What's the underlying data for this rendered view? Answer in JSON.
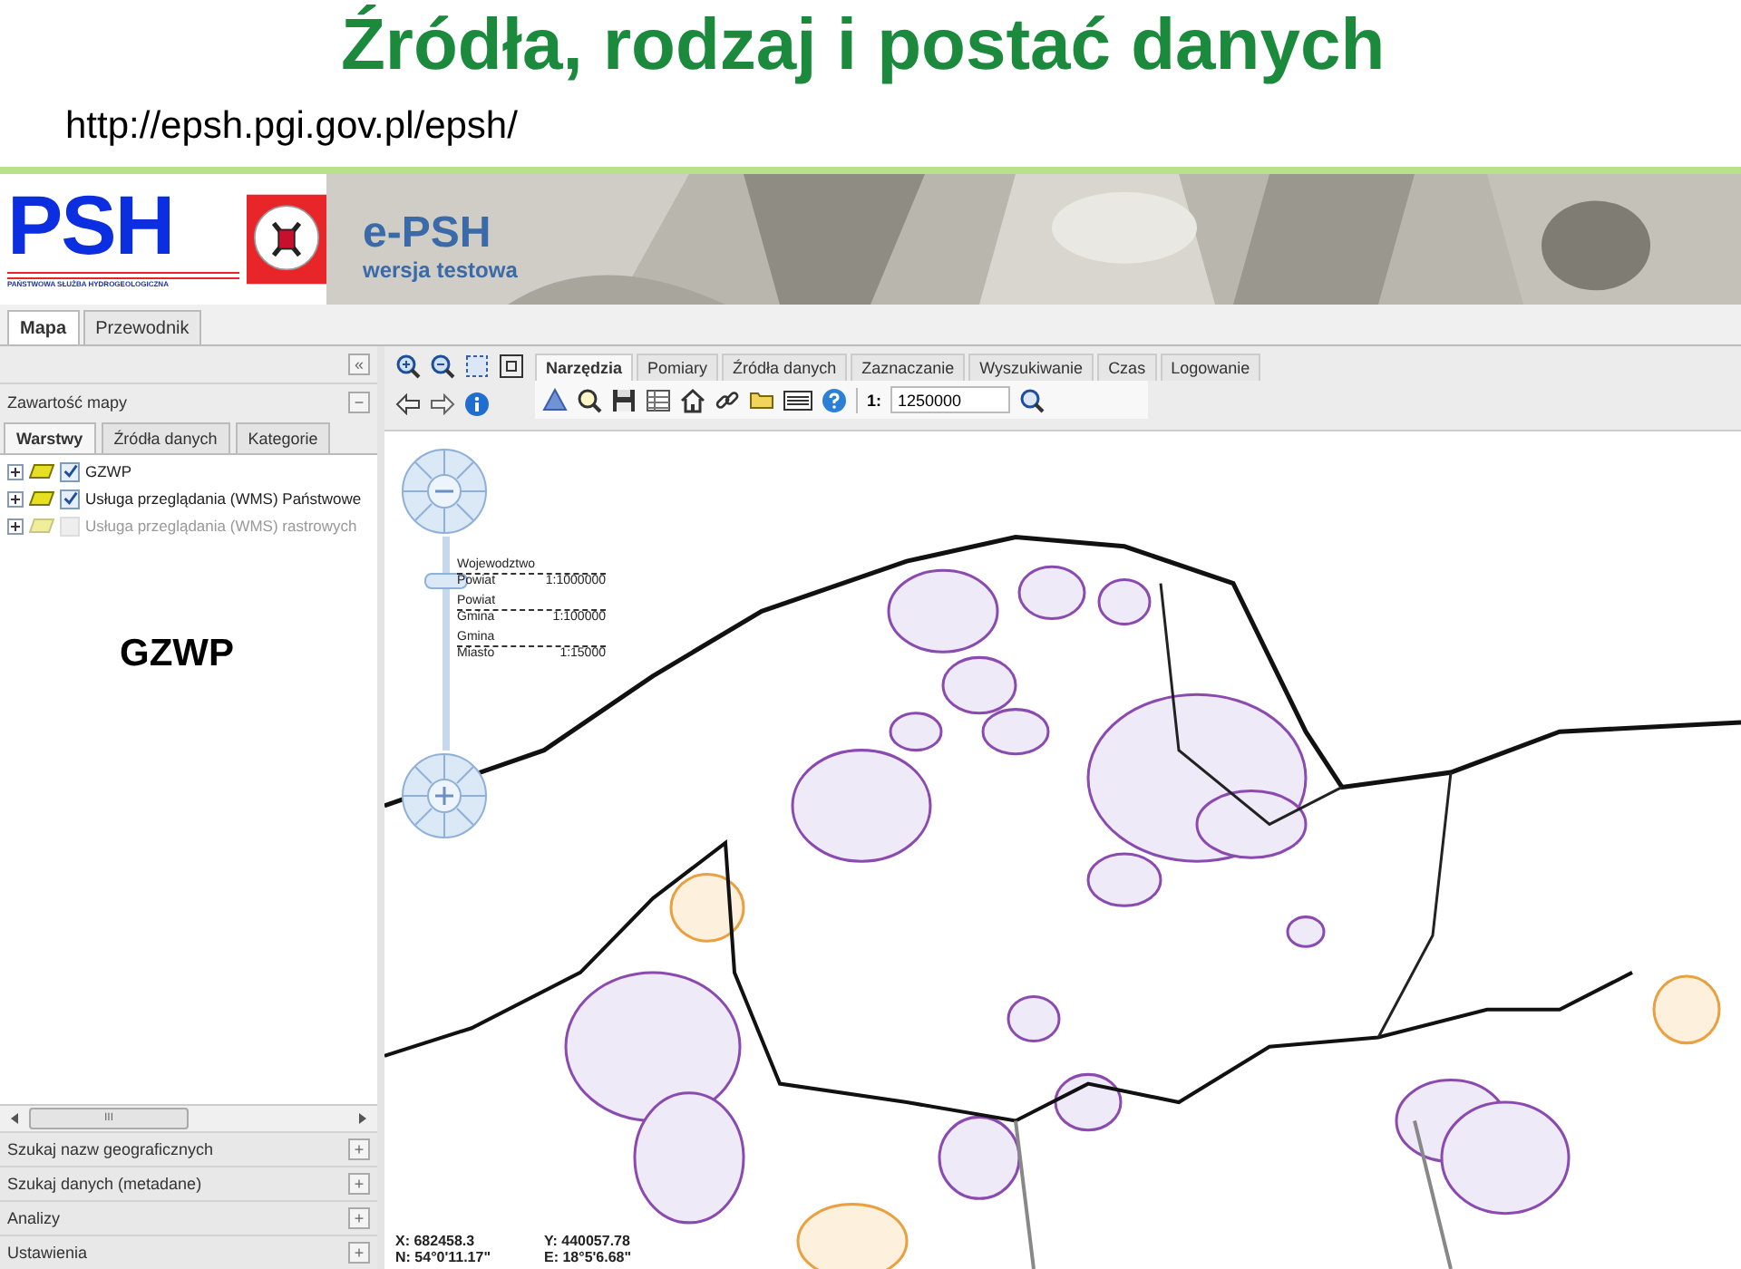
{
  "slide": {
    "title": "Źródła, rodzaj i postać danych",
    "url": "http://epsh.pgi.gov.pl/epsh/",
    "overlay_label": "GZWP"
  },
  "header": {
    "logo_text": "PSH",
    "logo_subtitle": "PAŃSTWOWA SŁUŻBA HYDROGEOLOGICZNA",
    "app_name": "e-PSH",
    "app_subtitle": "wersja testowa"
  },
  "main_tabs": [
    {
      "label": "Mapa",
      "selected": true
    },
    {
      "label": "Przewodnik",
      "selected": false
    }
  ],
  "left_panel": {
    "collapse": "«",
    "title": "Zawartość mapy",
    "minimize": "−",
    "tabs": [
      {
        "label": "Warstwy",
        "selected": true
      },
      {
        "label": "Źródła danych",
        "selected": false
      },
      {
        "label": "Kategorie",
        "selected": false
      }
    ],
    "layers": [
      {
        "label": "GZWP",
        "checked": true,
        "disabled": false
      },
      {
        "label": "Usługa przeglądania (WMS) Państwowe",
        "checked": true,
        "disabled": false
      },
      {
        "label": "Usługa przeglądania (WMS) rastrowych",
        "checked": false,
        "disabled": true
      }
    ],
    "scroll_grip": "III",
    "sections": [
      {
        "label": "Szukaj nazw geograficznych",
        "expand": "+"
      },
      {
        "label": "Szukaj danych (metadane)",
        "expand": "+"
      },
      {
        "label": "Analizy",
        "expand": "+"
      },
      {
        "label": "Ustawienia",
        "expand": "+"
      }
    ]
  },
  "toolbar": {
    "tabs": [
      {
        "label": "Narzędzia",
        "selected": true
      },
      {
        "label": "Pomiary",
        "selected": false
      },
      {
        "label": "Źródła danych",
        "selected": false
      },
      {
        "label": "Zaznaczanie",
        "selected": false
      },
      {
        "label": "Wyszukiwanie",
        "selected": false
      },
      {
        "label": "Czas",
        "selected": false
      },
      {
        "label": "Logowanie",
        "selected": false
      }
    ],
    "scale_prefix": "1:",
    "scale_value": "1250000"
  },
  "map": {
    "zoom_slider": {
      "level": 0.8
    },
    "scale_levels": [
      {
        "upper": "Wojewodztwo",
        "lower": "Powiat",
        "scale": "1:1000000"
      },
      {
        "upper": "Powiat",
        "lower": "Gmina",
        "scale": "1:100000"
      },
      {
        "upper": "Gmina",
        "lower": "Miasto",
        "scale": "1:15000"
      }
    ],
    "coordinates": [
      {
        "first": "X: 682458.3",
        "second": "Y: 440057.78"
      },
      {
        "first": "N: 54°0'11.17\"",
        "second": "E: 18°5'6.68\""
      }
    ]
  }
}
